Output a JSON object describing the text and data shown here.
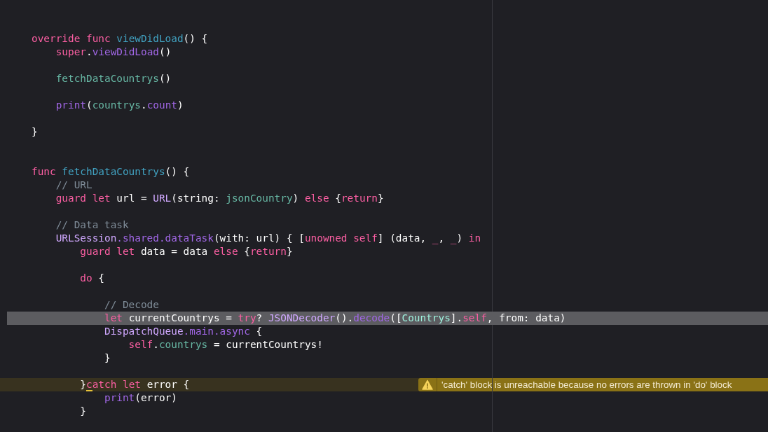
{
  "editor": {
    "lines": [
      {
        "kind": "blank"
      },
      {
        "kind": "blank"
      },
      {
        "kind": "blank"
      },
      {
        "kind": "code",
        "tokens": [
          {
            "kind": "keyword",
            "text": "override func"
          },
          {
            "kind": "declaration",
            "text": " viewDidLoad"
          },
          {
            "kind": "plain",
            "text": "() {"
          }
        ]
      },
      {
        "kind": "code",
        "tokens": [
          {
            "kind": "keyword",
            "text": "    super"
          },
          {
            "kind": "plain",
            "text": "."
          },
          {
            "kind": "system",
            "text": "viewDidLoad"
          },
          {
            "kind": "plain",
            "text": "()"
          }
        ]
      },
      {
        "kind": "blank"
      },
      {
        "kind": "code",
        "tokens": [
          {
            "kind": "project",
            "text": "    fetchDataCountrys"
          },
          {
            "kind": "plain",
            "text": "()"
          }
        ]
      },
      {
        "kind": "blank"
      },
      {
        "kind": "code",
        "tokens": [
          {
            "kind": "system",
            "text": "    print"
          },
          {
            "kind": "plain",
            "text": "("
          },
          {
            "kind": "project",
            "text": "countrys"
          },
          {
            "kind": "plain",
            "text": "."
          },
          {
            "kind": "system",
            "text": "count"
          },
          {
            "kind": "plain",
            "text": ")"
          }
        ]
      },
      {
        "kind": "blank"
      },
      {
        "kind": "code",
        "tokens": [
          {
            "kind": "plain",
            "text": "}"
          }
        ]
      },
      {
        "kind": "blank"
      },
      {
        "kind": "blank"
      },
      {
        "kind": "code",
        "tokens": [
          {
            "kind": "keyword",
            "text": "func"
          },
          {
            "kind": "declaration",
            "text": " fetchDataCountrys"
          },
          {
            "kind": "plain",
            "text": "() {"
          }
        ]
      },
      {
        "kind": "code",
        "tokens": [
          {
            "kind": "comment",
            "text": "    // URL"
          }
        ]
      },
      {
        "kind": "code",
        "tokens": [
          {
            "kind": "keyword",
            "text": "    guard let"
          },
          {
            "kind": "plain",
            "text": " url = "
          },
          {
            "kind": "system_type",
            "text": "URL"
          },
          {
            "kind": "plain",
            "text": "(string: "
          },
          {
            "kind": "project",
            "text": "jsonCountry"
          },
          {
            "kind": "plain",
            "text": ") "
          },
          {
            "kind": "keyword",
            "text": "else"
          },
          {
            "kind": "plain",
            "text": " {"
          },
          {
            "kind": "keyword",
            "text": "return"
          },
          {
            "kind": "plain",
            "text": "}"
          }
        ]
      },
      {
        "kind": "blank"
      },
      {
        "kind": "code",
        "tokens": [
          {
            "kind": "comment",
            "text": "    // Data task"
          }
        ]
      },
      {
        "kind": "code",
        "tokens": [
          {
            "kind": "system_type",
            "text": "    URLSession"
          },
          {
            "kind": "system",
            "text": ".shared.dataTask"
          },
          {
            "kind": "plain",
            "text": "(with: url) { ["
          },
          {
            "kind": "keyword",
            "text": "unowned self"
          },
          {
            "kind": "plain",
            "text": "] (data, "
          },
          {
            "kind": "keyword",
            "text": "_"
          },
          {
            "kind": "plain",
            "text": ", "
          },
          {
            "kind": "keyword",
            "text": "_"
          },
          {
            "kind": "plain",
            "text": ") "
          },
          {
            "kind": "keyword",
            "text": "in"
          }
        ]
      },
      {
        "kind": "code",
        "tokens": [
          {
            "kind": "keyword",
            "text": "        guard let"
          },
          {
            "kind": "plain",
            "text": " data = data "
          },
          {
            "kind": "keyword",
            "text": "else"
          },
          {
            "kind": "plain",
            "text": " {"
          },
          {
            "kind": "keyword",
            "text": "return"
          },
          {
            "kind": "plain",
            "text": "}"
          }
        ]
      },
      {
        "kind": "blank"
      },
      {
        "kind": "code",
        "tokens": [
          {
            "kind": "keyword",
            "text": "        do"
          },
          {
            "kind": "plain",
            "text": " {"
          }
        ]
      },
      {
        "kind": "blank"
      },
      {
        "kind": "code",
        "tokens": [
          {
            "kind": "comment",
            "text": "            // Decode"
          }
        ]
      },
      {
        "kind": "code",
        "current": true,
        "tokens": [
          {
            "kind": "keyword",
            "text": "            let"
          },
          {
            "kind": "plain",
            "text": " currentCountrys = "
          },
          {
            "kind": "keyword",
            "text": "try"
          },
          {
            "kind": "plain",
            "text": "? "
          },
          {
            "kind": "system_type",
            "text": "JSONDecoder"
          },
          {
            "kind": "plain",
            "text": "()."
          },
          {
            "kind": "system",
            "text": "decode"
          },
          {
            "kind": "plain",
            "text": "(["
          },
          {
            "kind": "project_type",
            "text": "Countrys"
          },
          {
            "kind": "plain",
            "text": "]."
          },
          {
            "kind": "keyword",
            "text": "self"
          },
          {
            "kind": "plain",
            "text": ", from: data)"
          }
        ]
      },
      {
        "kind": "code",
        "tokens": [
          {
            "kind": "system_type",
            "text": "            DispatchQueue"
          },
          {
            "kind": "system",
            "text": ".main.async"
          },
          {
            "kind": "plain",
            "text": " {"
          }
        ]
      },
      {
        "kind": "code",
        "tokens": [
          {
            "kind": "keyword",
            "text": "                self"
          },
          {
            "kind": "plain",
            "text": "."
          },
          {
            "kind": "project",
            "text": "countrys"
          },
          {
            "kind": "plain",
            "text": " = currentCountrys!"
          }
        ]
      },
      {
        "kind": "code",
        "tokens": [
          {
            "kind": "plain",
            "text": "            }"
          }
        ]
      },
      {
        "kind": "blank"
      },
      {
        "kind": "code",
        "warning": "'catch' block is unreachable because no errors are thrown in 'do' block",
        "tokens": [
          {
            "kind": "plain",
            "text": "        }"
          },
          {
            "kind": "keyword",
            "text": "c",
            "flagged": true
          },
          {
            "kind": "keyword",
            "text": "atch let"
          },
          {
            "kind": "plain",
            "text": " error {"
          }
        ]
      },
      {
        "kind": "code",
        "tokens": [
          {
            "kind": "system",
            "text": "            print"
          },
          {
            "kind": "plain",
            "text": "(error)"
          }
        ]
      },
      {
        "kind": "code",
        "tokens": [
          {
            "kind": "plain",
            "text": "        }"
          }
        ]
      },
      {
        "kind": "blank"
      }
    ]
  }
}
